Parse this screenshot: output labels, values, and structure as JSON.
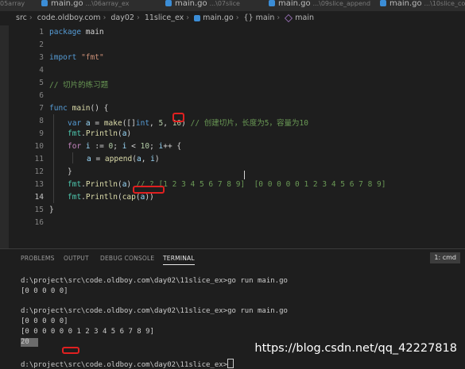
{
  "tabs": [
    {
      "name": "",
      "path": "05array"
    },
    {
      "name": "main.go",
      "path": "...\\06array_ex"
    },
    {
      "name": "main.go",
      "path": "...\\07slice"
    },
    {
      "name": "main.go",
      "path": "...\\09slice_append"
    },
    {
      "name": "main.go",
      "path": "...\\10slice_cop"
    }
  ],
  "breadcrumb": [
    "src",
    "code.oldboy.com",
    "day02",
    "11slice_ex",
    "main.go",
    "{} main",
    "main"
  ],
  "editor": {
    "line_numbers": [
      "1",
      "2",
      "3",
      "4",
      "5",
      "6",
      "7",
      "8",
      "9",
      "10",
      "11",
      "12",
      "13",
      "14",
      "15",
      "16"
    ],
    "active_line": "14",
    "code": {
      "l1": [
        "package",
        " main"
      ],
      "l3": [
        "import",
        " ",
        "\"fmt\""
      ],
      "l5": "// 切片的练习题",
      "l7": [
        "func",
        " ",
        "main",
        "() {"
      ],
      "l8": [
        "var",
        " ",
        "a",
        " = ",
        "make",
        "([]",
        "int",
        ", ",
        "5",
        ", ",
        "10",
        ") ",
        "// 创建切片，长度为5，容量为10"
      ],
      "l9": [
        "fmt",
        ".",
        "Println",
        "(",
        "a",
        ")"
      ],
      "l10": [
        "for",
        " ",
        "i",
        " := ",
        "0",
        "; ",
        "i",
        " < ",
        "10",
        "; ",
        "i",
        "++ {"
      ],
      "l11": [
        "a",
        " = ",
        "append",
        "(",
        "a",
        ", ",
        "i",
        ")"
      ],
      "l12": "}",
      "l13": [
        "fmt",
        ".",
        "Println",
        "(",
        "a",
        ") ",
        "// ? [1 2 3 4 5 6 7 8 9]  [0 0 0 0 0 1 2 3 4 5 6 7 8 9]"
      ],
      "l14": [
        "fmt",
        ".",
        "Println",
        "(",
        "cap",
        "(",
        "a",
        "))"
      ],
      "l15": "}"
    }
  },
  "panel": {
    "tabs": [
      "PROBLEMS",
      "OUTPUT",
      "DEBUG CONSOLE",
      "TERMINAL"
    ],
    "active_tab": "TERMINAL",
    "terminal_selector": "1: cmd",
    "lines": [
      "d:\\project\\src\\code.oldboy.com\\day02\\11slice_ex>go run main.go",
      "[0 0 0 0 0]",
      "d:\\project\\src\\code.oldboy.com\\day02\\11slice_ex>go run main.go",
      "[0 0 0 0 0]",
      "[0 0 0 0 0 0 1 2 3 4 5 6 7 8 9]",
      "20",
      "d:\\project\\src\\code.oldboy.com\\day02\\11slice_ex>"
    ]
  },
  "watermark": "https://blog.csdn.net/qq_42227818",
  "colors": {
    "keyword": "#569cd6",
    "control": "#c586c0",
    "string": "#ce9178",
    "number": "#b5cea8",
    "comment": "#6a9955",
    "function": "#dcdcaa",
    "variable": "#9cdcfe",
    "type": "#4ec9b0",
    "annotation": "#e02020"
  }
}
